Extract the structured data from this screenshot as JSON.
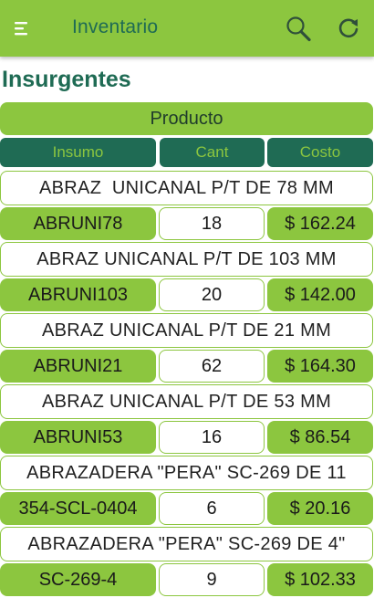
{
  "appbar": {
    "title": "Inventario",
    "icons": [
      "menu-icon",
      "search-icon",
      "refresh-icon"
    ]
  },
  "section": {
    "title": "Insurgentes"
  },
  "table": {
    "group_header": "Producto",
    "columns": [
      "Insumo",
      "Cant",
      "Costo"
    ],
    "rows": [
      {
        "name": "ABRAZ  UNICANAL P/T DE 78 MM",
        "code": "ABRUNI78",
        "qty": "18",
        "cost": "$ 162.24"
      },
      {
        "name": "ABRAZ UNICANAL P/T DE 103 MM",
        "code": "ABRUNI103",
        "qty": "20",
        "cost": "$ 142.00"
      },
      {
        "name": "ABRAZ UNICANAL P/T DE 21 MM",
        "code": "ABRUNI21",
        "qty": "62",
        "cost": "$ 164.30"
      },
      {
        "name": "ABRAZ UNICANAL P/T DE 53 MM",
        "code": "ABRUNI53",
        "qty": "16",
        "cost": "$ 86.54"
      },
      {
        "name": "ABRAZADERA \"PERA\" SC-269 DE 11",
        "code": "354-SCL-0404",
        "qty": "6",
        "cost": "$ 20.16"
      },
      {
        "name": "ABRAZADERA \"PERA\" SC-269 DE 4\"",
        "code": "SC-269-4",
        "qty": "9",
        "cost": "$ 102.33"
      }
    ]
  },
  "colors": {
    "primary_green": "#8cc63f",
    "dark_teal": "#1f6b54",
    "background": "#ffffff"
  }
}
